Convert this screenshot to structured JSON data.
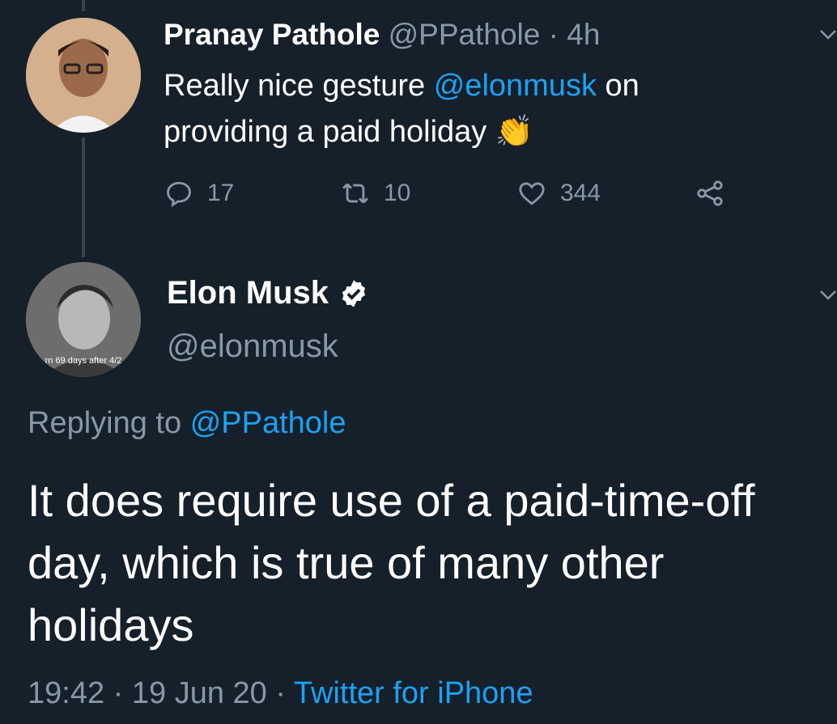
{
  "tweet_parent": {
    "name": "Pranay Pathole",
    "handle": "@PPathole",
    "separator": "·",
    "time": "4h",
    "text_part1": "Really nice gesture ",
    "mention": "@elonmusk",
    "text_part2": " on providing a paid holiday",
    "emoji": "👏",
    "stats": {
      "replies": "17",
      "retweets": "10",
      "likes": "344"
    }
  },
  "tweet_main": {
    "name": "Elon Musk",
    "handle": "@elonmusk",
    "avatar_caption": "rn 69 days after 4/2",
    "replying_label": "Replying to",
    "replying_handle": "@PPathole",
    "text": "It does require use of a paid-time-off day, which is true of many other holidays",
    "time": "19:42",
    "date": "19 Jun 20",
    "separator": "·",
    "source": "Twitter for iPhone"
  },
  "icons": [
    "reply-icon",
    "retweet-icon",
    "like-icon",
    "share-icon",
    "verified-badge-icon",
    "chevron-down-icon"
  ],
  "colors": {
    "background": "#15202b",
    "link": "#1da1f2",
    "muted": "#8899a6",
    "text": "#ffffff"
  }
}
